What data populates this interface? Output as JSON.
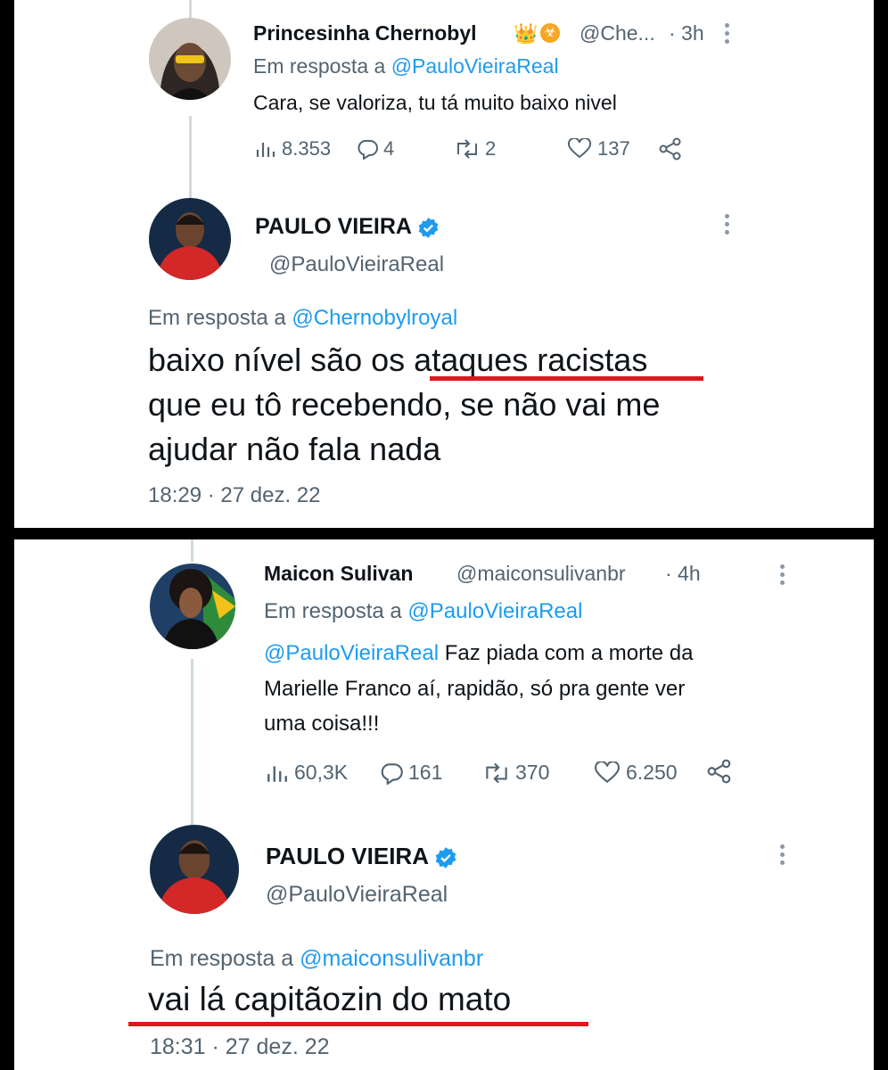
{
  "top": {
    "reply": {
      "name": "Princesinha Chernobyl",
      "handle": "@Che...",
      "time": "· 3h",
      "reply_prefix": "Em resposta a",
      "reply_to": "@PauloVieiraReal",
      "text": "Cara, se valoriza, tu tá muito baixo nivel",
      "stats": {
        "views": "8.353",
        "replies": "4",
        "retweets": "2",
        "likes": "137"
      }
    },
    "main": {
      "name": "PAULO VIEIRA",
      "handle": "@PauloVieiraReal",
      "reply_prefix": "Em resposta a",
      "reply_to": "@Chernobylroyal",
      "lines": [
        "baixo nível são os ataques racistas",
        "que eu tô recebendo, se não vai me",
        "ajudar não fala nada"
      ],
      "timestamp": "18:29 · 27 dez. 22"
    }
  },
  "bottom": {
    "reply": {
      "name": "Maicon Sulivan",
      "handle": "@maiconsulivanbr",
      "time": "· 4h",
      "reply_prefix": "Em resposta a",
      "reply_to": "@PauloVieiraReal",
      "mention": "@PauloVieiraReal",
      "text_line1": " Faz piada com a morte da",
      "text_line2": "Marielle Franco aí, rapidão, só pra gente ver",
      "text_line3": "uma coisa!!!",
      "stats": {
        "views": "60,3K",
        "replies": "161",
        "retweets": "370",
        "likes": "6.250"
      }
    },
    "main": {
      "name": "PAULO VIEIRA",
      "handle": "@PauloVieiraReal",
      "reply_prefix": "Em resposta a",
      "reply_to": "@maiconsulivanbr",
      "text": "vai lá capitãozin do mato",
      "timestamp": "18:31 · 27 dez. 22"
    }
  },
  "colors": {
    "link": "#1d9bf0",
    "underline": "#e0161c",
    "verified": "#1d9bf0",
    "gray": "#536471"
  },
  "icons": [
    "views-icon",
    "reply-icon",
    "retweet-icon",
    "like-icon",
    "share-icon",
    "verified-icon",
    "more-icon",
    "crown-emoji",
    "biohazard-emoji"
  ]
}
